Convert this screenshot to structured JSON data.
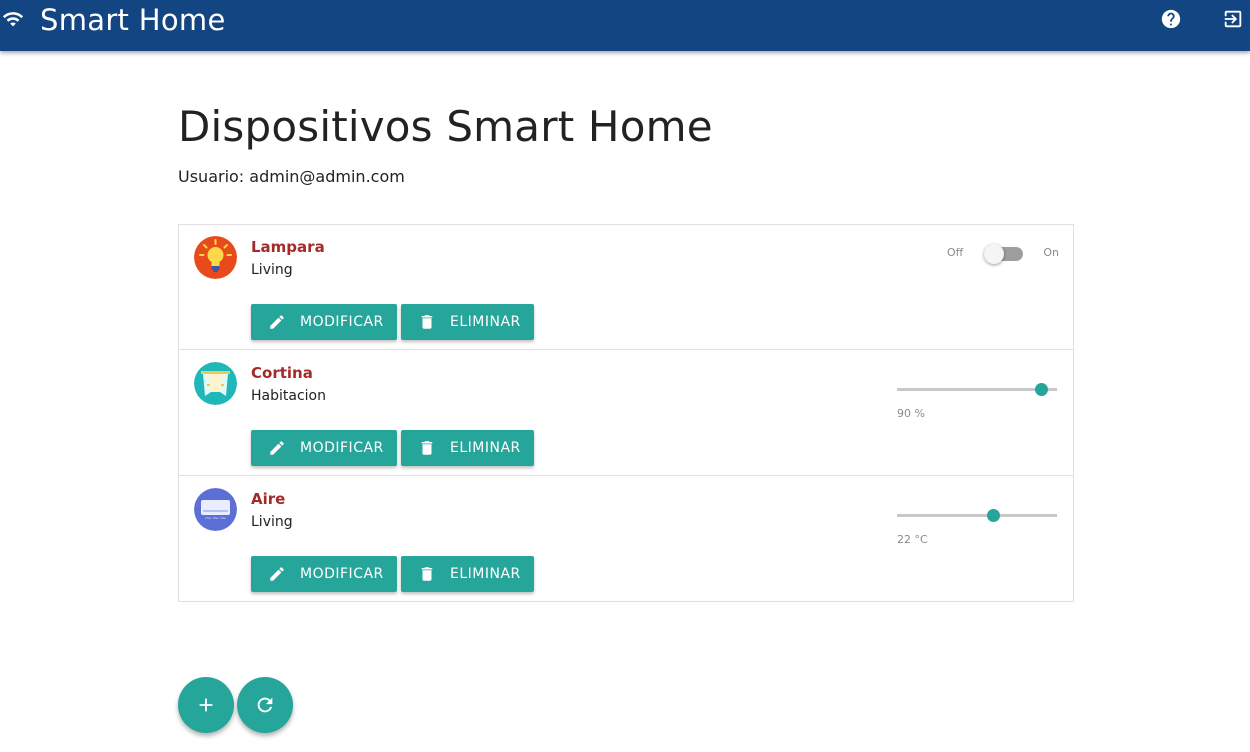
{
  "header": {
    "app_title": "Smart Home",
    "icons": {
      "left": "wifi-icon",
      "help": "help-icon",
      "logout": "logout-icon"
    },
    "bar_color": "#134582"
  },
  "main": {
    "title": "Dispositivos Smart Home",
    "user_label": "Usuario:",
    "user_email": "admin@admin.com"
  },
  "devices": [
    {
      "name": "Lampara",
      "room": "Living",
      "icon": "lightbulb-icon",
      "control": "switch",
      "switch": {
        "off_label": "Off",
        "on_label": "On",
        "state": false
      },
      "modify_label": "MODIFICAR",
      "delete_label": "ELIMINAR"
    },
    {
      "name": "Cortina",
      "room": "Habitacion",
      "icon": "curtain-icon",
      "control": "slider",
      "slider": {
        "value": 90,
        "min": 0,
        "max": 100,
        "label": "90 %"
      },
      "modify_label": "MODIFICAR",
      "delete_label": "ELIMINAR"
    },
    {
      "name": "Aire",
      "room": "Living",
      "icon": "air-conditioner-icon",
      "control": "slider",
      "slider": {
        "value": 22,
        "min": 16,
        "max": 26,
        "label": "22 °C"
      },
      "modify_label": "MODIFICAR",
      "delete_label": "ELIMINAR"
    }
  ],
  "actions": {
    "add_icon": "plus-icon",
    "refresh_icon": "refresh-icon"
  },
  "colors": {
    "accent": "#26a69a",
    "device_name": "#a52a2a"
  }
}
